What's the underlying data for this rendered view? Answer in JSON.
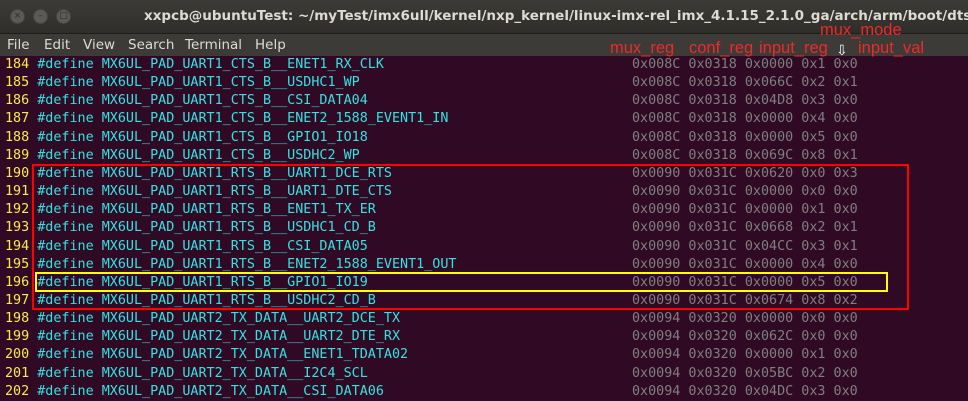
{
  "window": {
    "title": "xxpcb@ubuntuTest: ~/myTest/imx6ull/kernel/nxp_kernel/linux-imx-rel_imx_4.1.15_2.1.0_ga/arch/arm/boot/dts",
    "close_glyph": "×",
    "min_glyph": "–",
    "max_glyph": "□"
  },
  "menu": [
    "File",
    "Edit",
    "View",
    "Search",
    "Terminal",
    "Help"
  ],
  "annotations": {
    "mux_reg": "mux_reg",
    "conf_reg": "conf_reg",
    "input_reg": "input_reg",
    "mux_mode": "mux_mode",
    "input_val": "input_val",
    "arrow_glyph": "⇩"
  },
  "colors": {
    "background": "#300a24",
    "line_number": "#fce94f",
    "define_text": "#34e2e2",
    "values": "#7f7f7f",
    "annotation": "#ef2929",
    "highlight_red": "#ff0000",
    "highlight_yellow": "#ffff00"
  },
  "lines": [
    {
      "num": "184",
      "keyword": "#define",
      "macro": "MX6UL_PAD_UART1_CTS_B__ENET1_RX_CLK",
      "values": "0x008C 0x0318 0x0000 0x1 0x0"
    },
    {
      "num": "185",
      "keyword": "#define",
      "macro": "MX6UL_PAD_UART1_CTS_B__USDHC1_WP",
      "values": "0x008C 0x0318 0x066C 0x2 0x1"
    },
    {
      "num": "186",
      "keyword": "#define",
      "macro": "MX6UL_PAD_UART1_CTS_B__CSI_DATA04",
      "values": "0x008C 0x0318 0x04D8 0x3 0x0"
    },
    {
      "num": "187",
      "keyword": "#define",
      "macro": "MX6UL_PAD_UART1_CTS_B__ENET2_1588_EVENT1_IN",
      "values": "0x008C 0x0318 0x0000 0x4 0x0"
    },
    {
      "num": "188",
      "keyword": "#define",
      "macro": "MX6UL_PAD_UART1_CTS_B__GPIO1_IO18",
      "values": "0x008C 0x0318 0x0000 0x5 0x0"
    },
    {
      "num": "189",
      "keyword": "#define",
      "macro": "MX6UL_PAD_UART1_CTS_B__USDHC2_WP",
      "values": "0x008C 0x0318 0x069C 0x8 0x1"
    },
    {
      "num": "190",
      "keyword": "#define",
      "macro": "MX6UL_PAD_UART1_RTS_B__UART1_DCE_RTS",
      "values": "0x0090 0x031C 0x0620 0x0 0x3"
    },
    {
      "num": "191",
      "keyword": "#define",
      "macro": "MX6UL_PAD_UART1_RTS_B__UART1_DTE_CTS",
      "values": "0x0090 0x031C 0x0000 0x0 0x0"
    },
    {
      "num": "192",
      "keyword": "#define",
      "macro": "MX6UL_PAD_UART1_RTS_B__ENET1_TX_ER",
      "values": "0x0090 0x031C 0x0000 0x1 0x0"
    },
    {
      "num": "193",
      "keyword": "#define",
      "macro": "MX6UL_PAD_UART1_RTS_B__USDHC1_CD_B",
      "values": "0x0090 0x031C 0x0668 0x2 0x1"
    },
    {
      "num": "194",
      "keyword": "#define",
      "macro": "MX6UL_PAD_UART1_RTS_B__CSI_DATA05",
      "values": "0x0090 0x031C 0x04CC 0x3 0x1"
    },
    {
      "num": "195",
      "keyword": "#define",
      "macro": "MX6UL_PAD_UART1_RTS_B__ENET2_1588_EVENT1_OUT",
      "values": "0x0090 0x031C 0x0000 0x4 0x0"
    },
    {
      "num": "196",
      "keyword": "#define",
      "macro": "MX6UL_PAD_UART1_RTS_B__GPIO1_IO19",
      "values": "0x0090 0x031C 0x0000 0x5 0x0"
    },
    {
      "num": "197",
      "keyword": "#define",
      "macro": "MX6UL_PAD_UART1_RTS_B__USDHC2_CD_B",
      "values": "0x0090 0x031C 0x0674 0x8 0x2"
    },
    {
      "num": "198",
      "keyword": "#define",
      "macro": "MX6UL_PAD_UART2_TX_DATA__UART2_DCE_TX",
      "values": "0x0094 0x0320 0x0000 0x0 0x0"
    },
    {
      "num": "199",
      "keyword": "#define",
      "macro": "MX6UL_PAD_UART2_TX_DATA__UART2_DTE_RX",
      "values": "0x0094 0x0320 0x062C 0x0 0x0"
    },
    {
      "num": "200",
      "keyword": "#define",
      "macro": "MX6UL_PAD_UART2_TX_DATA__ENET1_TDATA02",
      "values": "0x0094 0x0320 0x0000 0x1 0x0"
    },
    {
      "num": "201",
      "keyword": "#define",
      "macro": "MX6UL_PAD_UART2_TX_DATA__I2C4_SCL",
      "values": "0x0094 0x0320 0x05BC 0x2 0x0"
    },
    {
      "num": "202",
      "keyword": "#define",
      "macro": "MX6UL_PAD_UART2_TX_DATA__CSI_DATA06",
      "values": "0x0094 0x0320 0x04DC 0x3 0x0"
    }
  ]
}
